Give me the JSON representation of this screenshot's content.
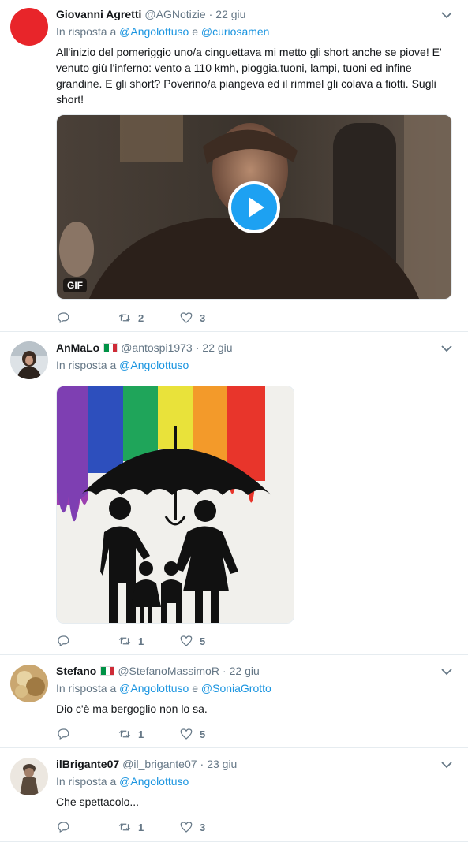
{
  "tweets": [
    {
      "name": "Giovanni Agretti",
      "handle": "@AGNotizie",
      "time": "22 giu",
      "reply_prefix": "In risposta a",
      "reply_to": [
        "@Angolottuso",
        "@curiosamen"
      ],
      "reply_joiner": "e",
      "text": "All'inizio del pomeriggio uno/a cinguettava mi metto gli short anche se piove!  E' venuto giù l'inferno: vento a 110 kmh, pioggia,tuoni, lampi, tuoni ed infine grandine. E gli short? Poverino/a piangeva ed il rimmel gli colava a fiotti. Sugli short!",
      "media_badge": "GIF",
      "retweets": "2",
      "likes": "3",
      "avatar_color": "#e8252a"
    },
    {
      "name": "AnMaLo",
      "handle": "@antospi1973",
      "time": "22 giu",
      "reply_prefix": "In risposta a",
      "reply_to": [
        "@Angolottuso"
      ],
      "retweets": "1",
      "likes": "5"
    },
    {
      "name": "Stefano",
      "handle": "@StefanoMassimoR",
      "time": "22 giu",
      "reply_prefix": "In risposta a",
      "reply_to": [
        "@Angolottuso",
        "@SoniaGrotto"
      ],
      "reply_joiner": "e",
      "text": "Dio c'è ma bergoglio non lo sa.",
      "retweets": "1",
      "likes": "5"
    },
    {
      "name": "ilBrigante07",
      "handle": "@il_brigante07",
      "time": "23 giu",
      "reply_prefix": "In risposta a",
      "reply_to": [
        "@Angolottuso"
      ],
      "text": "Che spettacolo...",
      "retweets": "1",
      "likes": "3"
    }
  ],
  "colors": {
    "link": "#1b95e0",
    "muted": "#657786",
    "divider": "#e6ecf0",
    "play_button": "#1da1f2"
  },
  "icons": [
    "reply-icon",
    "retweet-icon",
    "like-icon",
    "caret-down-icon",
    "play-icon",
    "italy-flag-icon"
  ]
}
